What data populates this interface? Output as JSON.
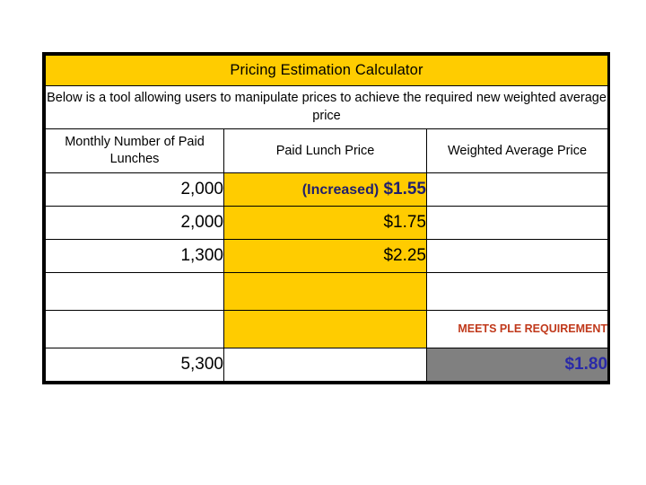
{
  "widget": {
    "title": "Pricing Estimation Calculator",
    "description": "Below is a tool allowing users to manipulate prices to achieve the required new weighted average price",
    "colors": {
      "title_bar": "#FFCC00",
      "editable_cell": "#FFCC00",
      "result_cell": "#808080",
      "increased_label": "#1F1F6E",
      "increased_price": "#1F1F6E",
      "result_value": "#2A2AA8",
      "ple_note": "#C0391B",
      "border": "#000000",
      "background": "#FFFFFF"
    }
  },
  "table": {
    "columns": [
      {
        "label": "Monthly Number of Paid Lunches"
      },
      {
        "label": "Paid Lunch Price"
      },
      {
        "label": "Weighted Average Price"
      }
    ],
    "rows": [
      {
        "lunches": "2,000",
        "price_prefix": "(Increased)",
        "price": "$1.55",
        "weighted_average": ""
      },
      {
        "lunches": "2,000",
        "price_prefix": "",
        "price": "$1.75",
        "weighted_average": ""
      },
      {
        "lunches": "1,300",
        "price_prefix": "",
        "price": "$2.25",
        "weighted_average": ""
      },
      {
        "lunches": "",
        "price_prefix": "",
        "price": "",
        "weighted_average": ""
      },
      {
        "lunches": "",
        "price_prefix": "",
        "price": "",
        "weighted_average": "MEETS PLE REQUIREMENT"
      }
    ],
    "total_row": {
      "lunches": "5,300",
      "price": "",
      "weighted_average": "$1.80"
    }
  }
}
